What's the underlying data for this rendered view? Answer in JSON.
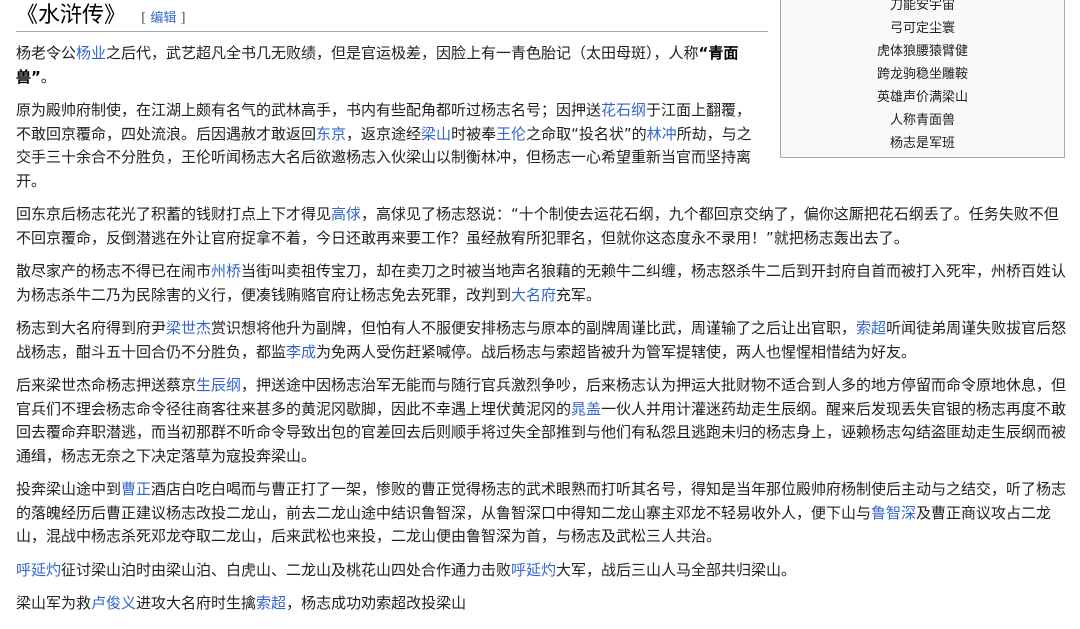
{
  "heading": {
    "title": "《水浒传》",
    "edit_open": "[",
    "edit_label": "编辑",
    "edit_close": "]"
  },
  "infobox": {
    "lines": [
      "刀能安宇宙",
      "弓可定尘寰",
      "虎体狼腰猿臂健",
      "跨龙驹稳坐雕鞍",
      "英雄声价满梁山",
      "人称青面兽",
      "杨志是军班"
    ]
  },
  "paragraphs": [
    {
      "narrow": true,
      "segments": [
        {
          "t": "杨老令公"
        },
        {
          "t": "杨业",
          "link": true
        },
        {
          "t": "之后代，武艺超凡全书几无败绩，但是官运极差，因脸上有一青色胎记（太田母斑），人称"
        },
        {
          "t": "“青面兽”",
          "bold": true
        },
        {
          "t": "。"
        }
      ]
    },
    {
      "narrow": true,
      "segments": [
        {
          "t": "原为殿帅府制使，在江湖上颇有名气的武林高手，书内有些配角都听过杨志名号；因押送"
        },
        {
          "t": "花石纲",
          "link": true
        },
        {
          "t": "于江面上翻覆，不敢回京覆命，四处流浪。后因遇赦才敢返回"
        },
        {
          "t": "东京",
          "link": true
        },
        {
          "t": "，返京途经"
        },
        {
          "t": "梁山",
          "link": true
        },
        {
          "t": "时被奉"
        },
        {
          "t": "王伦",
          "link": true
        },
        {
          "t": "之命取“投名状”的"
        },
        {
          "t": "林冲",
          "link": true
        },
        {
          "t": "所劫，与之交手三十余合不分胜负，王伦听闻杨志大名后欲邀杨志入伙梁山以制衡林冲，但杨志一心希望重新当官而坚持离开。"
        }
      ]
    },
    {
      "narrow": false,
      "segments": [
        {
          "t": "回东京后杨志花光了积蓄的钱财打点上下才得见"
        },
        {
          "t": "高俅",
          "link": true
        },
        {
          "t": "，高俅见了杨志怒说：“十个制使去运花石纲，九个都回京交纳了，偏你这厮把花石纲丢了。任务失败不但不回京覆命，反倒潜逃在外让官府捉拿不着，今日还敢再来要工作？虽经赦宥所犯罪名，但就你这态度永不录用！”就把杨志轰出去了。"
        }
      ]
    },
    {
      "narrow": false,
      "segments": [
        {
          "t": "散尽家产的杨志不得已在闹市"
        },
        {
          "t": "州桥",
          "link": true
        },
        {
          "t": "当街叫卖祖传宝刀，却在卖刀之时被当地声名狼藉的无赖牛二纠缠，杨志怒杀牛二后到开封府自首而被打入死牢，州桥百姓认为杨志杀牛二乃为民除害的义行，便凑钱贿赂官府让杨志免去死罪，改判到"
        },
        {
          "t": "大名府",
          "link": true
        },
        {
          "t": "充军。"
        }
      ]
    },
    {
      "narrow": false,
      "segments": [
        {
          "t": "杨志到大名府得到府尹"
        },
        {
          "t": "梁世杰",
          "link": true
        },
        {
          "t": "赏识想将他升为副牌，但怕有人不服便安排杨志与原本的副牌周谨比武，周谨输了之后让出官职，"
        },
        {
          "t": "索超",
          "link": true
        },
        {
          "t": "听闻徒弟周谨失败拔官后怒战杨志，酣斗五十回合仍不分胜负，都监"
        },
        {
          "t": "李成",
          "link": true
        },
        {
          "t": "为免两人受伤赶紧喊停。战后杨志与索超皆被升为管军提辖使，两人也惺惺相惜结为好友。"
        }
      ]
    },
    {
      "narrow": false,
      "segments": [
        {
          "t": "后来梁世杰命杨志押送蔡京"
        },
        {
          "t": "生辰纲",
          "link": true
        },
        {
          "t": "，押送途中因杨志治军无能而与随行官兵激烈争吵，后来杨志认为押运大批财物不适合到人多的地方停留而命令原地休息，但官兵们不理会杨志命令径往商客往来甚多的黄泥冈歇脚，因此不幸遇上埋伏黄泥冈的"
        },
        {
          "t": "晁盖",
          "link": true
        },
        {
          "t": "一伙人并用计灌迷药劫走生辰纲。醒来后发现丢失官银的杨志再度不敢回去覆命弃职潜逃，而当初那群不听命令导致出包的官差回去后则顺手将过失全部推到与他们有私怨且逃跑未归的杨志身上，诬赖杨志勾结盗匪劫走生辰纲而被通缉，杨志无奈之下决定落草为寇投奔梁山。"
        }
      ]
    },
    {
      "narrow": false,
      "segments": [
        {
          "t": "投奔梁山途中到"
        },
        {
          "t": "曹正",
          "link": true
        },
        {
          "t": "酒店白吃白喝而与曹正打了一架，惨败的曹正觉得杨志的武术眼熟而打听其名号，得知是当年那位殿帅府杨制使后主动与之结交，听了杨志的落魄经历后曹正建议杨志改投二龙山，前去二龙山途中结识鲁智深，从鲁智深口中得知二龙山寨主邓龙不轻易收外人，便下山与"
        },
        {
          "t": "鲁智深",
          "link": true
        },
        {
          "t": "及曹正商议攻占二龙山，混战中杨志杀死邓龙夺取二龙山，后来武松也来投，二龙山便由鲁智深为首，与杨志及武松三人共治。"
        }
      ]
    },
    {
      "narrow": false,
      "segments": [
        {
          "t": "呼延灼",
          "link": true
        },
        {
          "t": "征讨梁山泊时由梁山泊、白虎山、二龙山及桃花山四处合作通力击败"
        },
        {
          "t": "呼延灼",
          "link": true
        },
        {
          "t": "大军，战后三山人马全部共归梁山。"
        }
      ]
    },
    {
      "narrow": false,
      "segments": [
        {
          "t": "梁山军为救"
        },
        {
          "t": "卢俊义",
          "link": true
        },
        {
          "t": "进攻大名府时生擒"
        },
        {
          "t": "索超",
          "link": true
        },
        {
          "t": "，杨志成功劝索超改投梁山"
        }
      ]
    }
  ]
}
